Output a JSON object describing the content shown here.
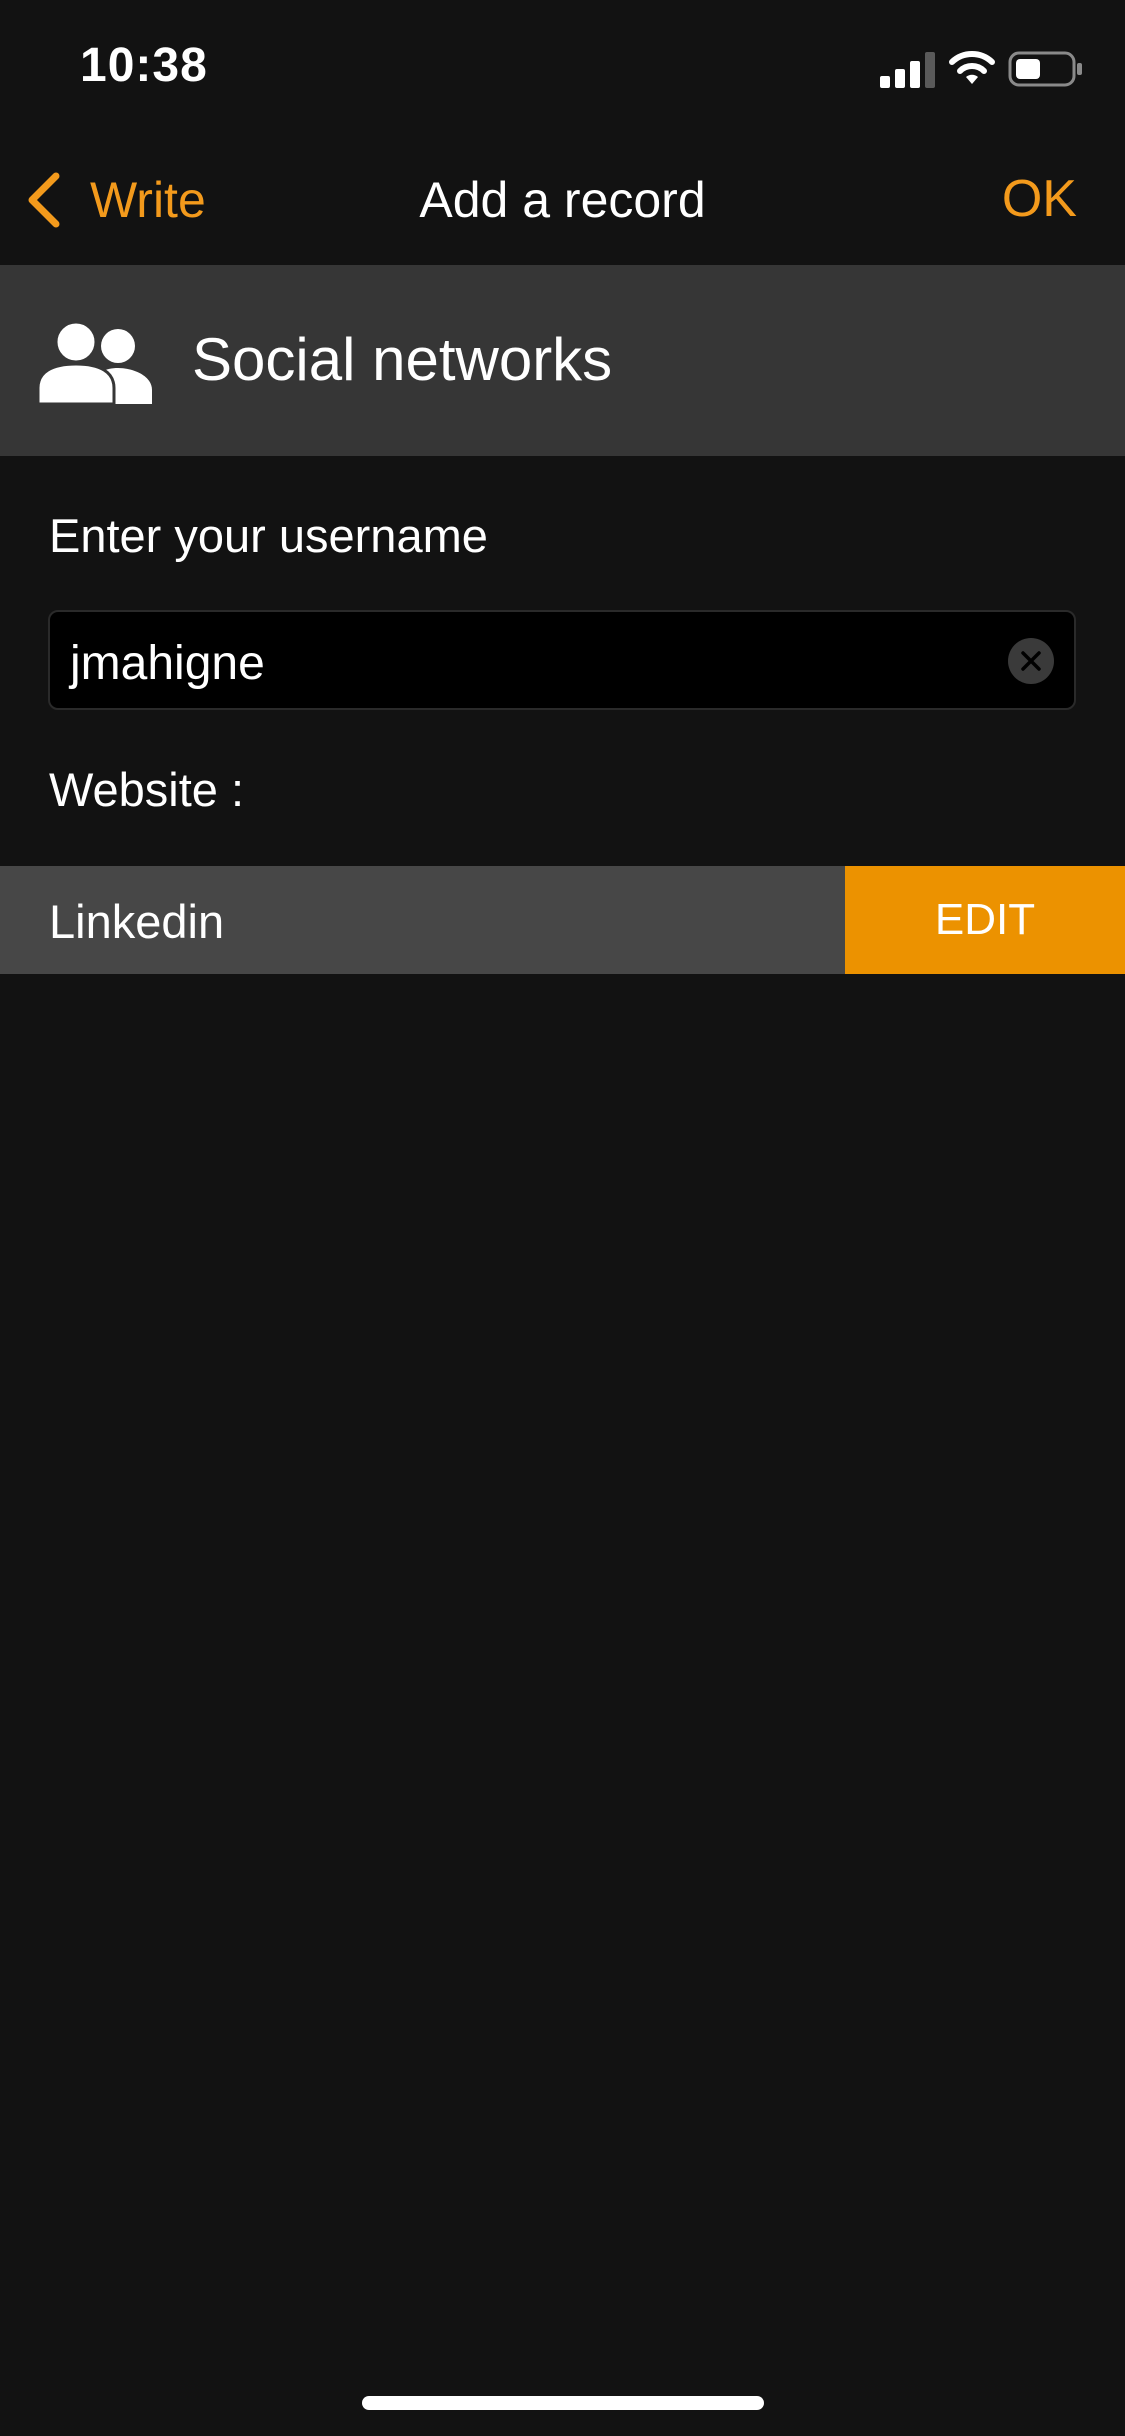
{
  "status_bar": {
    "time": "10:38"
  },
  "nav": {
    "back_label": "Write",
    "title": "Add a record",
    "ok_label": "OK"
  },
  "category": {
    "icon": "people-icon",
    "title": "Social networks"
  },
  "form": {
    "username_label": "Enter your username",
    "username_value": "jmahigne",
    "website_label": "Website :",
    "website_value": "Linkedin",
    "edit_label": "EDIT"
  },
  "colors": {
    "accent": "#f39a1c",
    "edit_button": "#ec9200",
    "background": "#121212",
    "header_background": "#363636",
    "row_background": "#474747"
  }
}
